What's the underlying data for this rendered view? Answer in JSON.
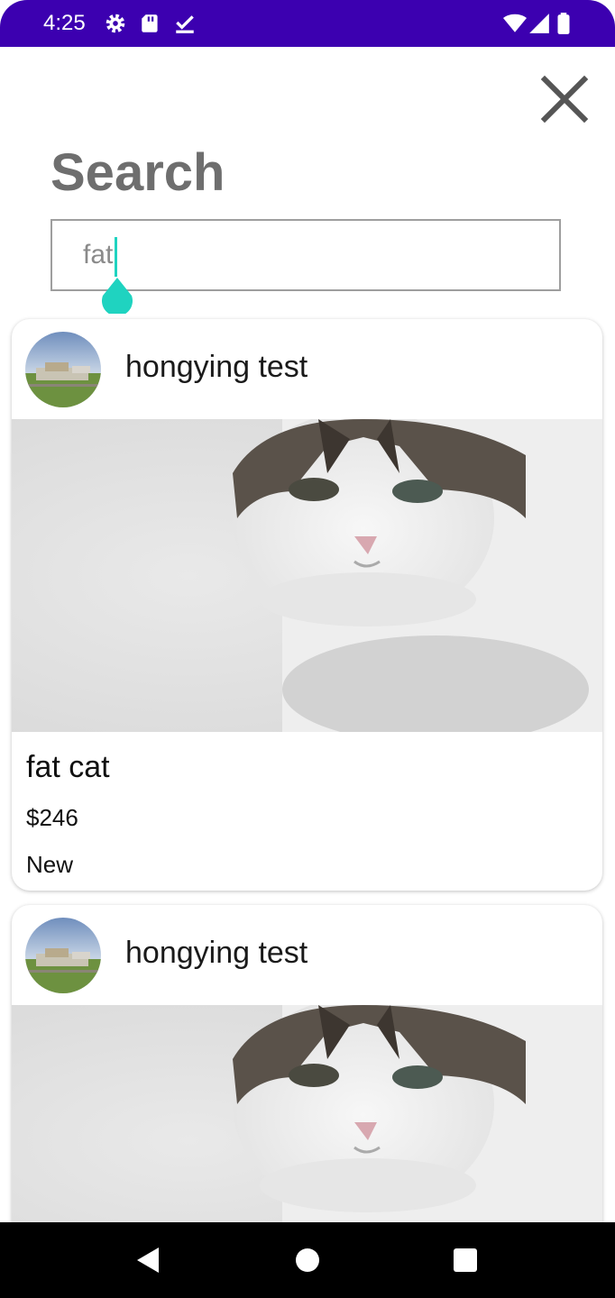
{
  "status_bar": {
    "time": "4:25",
    "icons_left": [
      "settings-icon",
      "sd-card-icon",
      "download-done-icon"
    ],
    "icons_right": [
      "wifi-icon",
      "signal-icon",
      "battery-icon"
    ],
    "color": "#3c00b0"
  },
  "header": {
    "title": "Search",
    "close_icon": "close-icon"
  },
  "search": {
    "value": "fat",
    "cursor_color": "#1fd3c0"
  },
  "results": [
    {
      "seller": "hongying test",
      "title": "fat cat",
      "price": "$246",
      "condition": "New"
    },
    {
      "seller": "hongying test"
    }
  ],
  "nav_bar": {
    "buttons": [
      "back-icon",
      "home-icon",
      "recents-icon"
    ]
  }
}
